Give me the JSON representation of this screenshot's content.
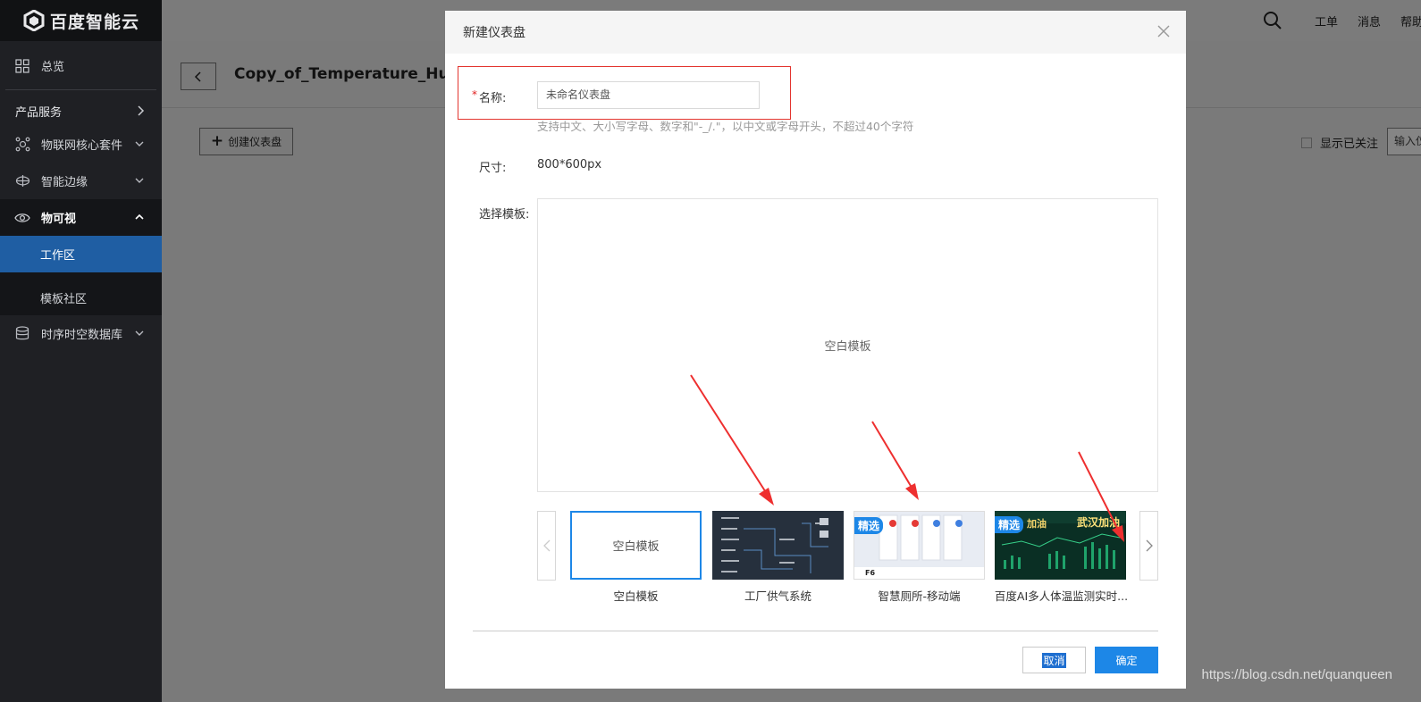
{
  "brand": {
    "name": "百度智能云"
  },
  "topbar": {
    "links": [
      "工单",
      "消息",
      "帮助"
    ]
  },
  "sidebar": {
    "overview": "总览",
    "section": "产品服务",
    "items": [
      {
        "label": "物联网核心套件"
      },
      {
        "label": "智能边缘"
      },
      {
        "label": "物可视"
      },
      {
        "label": "时序时空数据库"
      }
    ],
    "subitems": [
      "工作区",
      "模板社区"
    ]
  },
  "page": {
    "title": "Copy_of_Temperature_Humi",
    "create_button": "创建仪表盘",
    "follow_label": "显示已关注",
    "filter_placeholder": "输入仪"
  },
  "modal": {
    "title": "新建仪表盘",
    "required_mark": "*",
    "name_label": "名称:",
    "name_placeholder": "未命名仪表盘",
    "name_hint": "支持中文、大小写字母、数字和\"-_/.\"，以中文或字母开头，不超过40个字符",
    "size_label": "尺寸:",
    "size_value": "800*600px",
    "template_label": "选择模板:",
    "preview_text": "空白模板",
    "templates": [
      {
        "name": "空白模板",
        "thumb_text": "空白模板",
        "badge": ""
      },
      {
        "name": "工厂供气系统",
        "badge": ""
      },
      {
        "name": "智慧厕所-移动端",
        "badge": "精选",
        "thumb_tag": "F6"
      },
      {
        "name": "百度AI多人体温监测实时...",
        "badge": "精选",
        "thumb_words": [
          "加油",
          "武汉加油"
        ]
      }
    ],
    "cancel_label": "取消",
    "ok_label": "确定"
  },
  "watermark": "https://blog.csdn.net/quanqueen",
  "colors": {
    "sidebar": "#1f2024",
    "active": "#1f5ea3",
    "primary": "#1d87e7",
    "highlight": "#e3352f"
  }
}
